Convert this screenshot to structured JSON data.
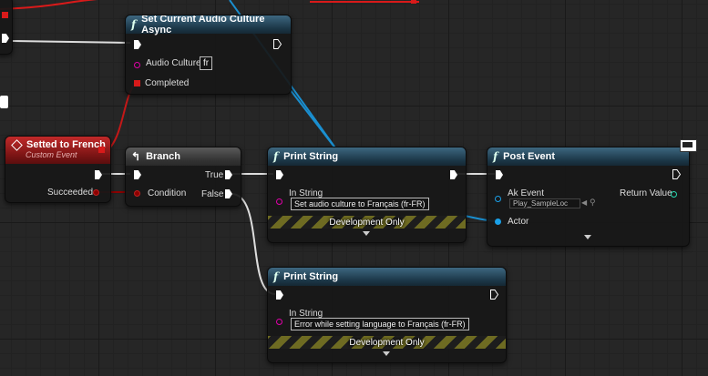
{
  "nodes": {
    "set_culture": {
      "title": "Set Current Audio Culture Async",
      "audio_culture_label": "Audio Culture",
      "audio_culture_value": "fr",
      "completed_label": "Completed"
    },
    "event": {
      "title": "Setted to French",
      "subtitle": "Custom Event",
      "succeeded_label": "Succeeded"
    },
    "branch": {
      "title": "Branch",
      "condition_label": "Condition",
      "true_label": "True",
      "false_label": "False"
    },
    "print1": {
      "title": "Print String",
      "in_string_label": "In String",
      "in_string_value": "Set audio culture to Français (fr-FR)",
      "dev_label": "Development Only"
    },
    "post_event": {
      "title": "Post Event",
      "ak_event_label": "Ak Event",
      "ak_event_value": "Play_SampleLoc",
      "actor_label": "Actor",
      "return_label": "Return Value"
    },
    "print2": {
      "title": "Print String",
      "in_string_label": "In String",
      "in_string_value": "Error while setting language to Français (fr-FR)",
      "dev_label": "Development Only"
    }
  },
  "colors": {
    "exec": "#ffffff",
    "string_pin": "#e000a8",
    "bool_pin": "#8c0000",
    "object_pin": "#1aa0e8",
    "red_wire": "#d81a1a",
    "blue_wire": "#1aa0e8"
  }
}
